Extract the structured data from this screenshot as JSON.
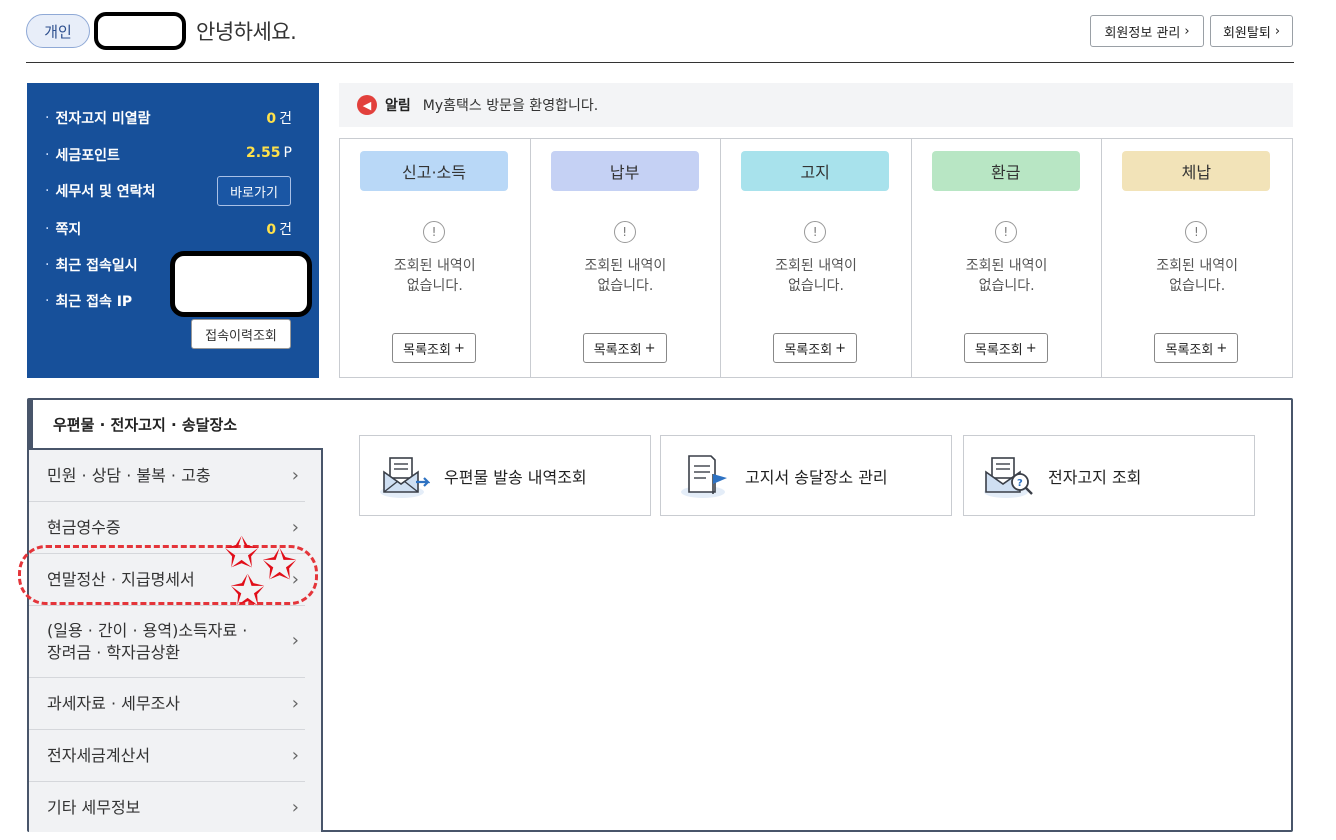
{
  "header": {
    "badge": "개인",
    "greeting": "안녕하세요.",
    "buttons": [
      {
        "label": "회원정보 관리",
        "chev": "›"
      },
      {
        "label": "회원탈퇴",
        "chev": "›"
      }
    ]
  },
  "info_box": {
    "rows": [
      {
        "label": "전자고지 미열람",
        "value": "0",
        "unit": "건"
      },
      {
        "label": "세금포인트",
        "value": "2.55",
        "unit": "P"
      },
      {
        "label": "세무서 및 연락처",
        "button": "바로가기"
      },
      {
        "label": "쪽지",
        "value": "0",
        "unit": "건"
      },
      {
        "label": "최근 접속일시"
      },
      {
        "label": "최근 접속 IP"
      }
    ],
    "history_button": "접속이력조회",
    "bullet": "·"
  },
  "notice": {
    "icon": "megaphone-icon",
    "label": "알림",
    "text": "My홈택스 방문을 환영합니다."
  },
  "categories": [
    {
      "title": "신고·소득",
      "color": "#b9d8f7",
      "message_1": "조회된 내역이",
      "message_2": "없습니다.",
      "button": "목록조회",
      "plus": "+"
    },
    {
      "title": "납부",
      "color": "#c5d1f4",
      "message_1": "조회된 내역이",
      "message_2": "없습니다.",
      "button": "목록조회",
      "plus": "+"
    },
    {
      "title": "고지",
      "color": "#a8e2ec",
      "message_1": "조회된 내역이",
      "message_2": "없습니다.",
      "button": "목록조회",
      "plus": "+"
    },
    {
      "title": "환급",
      "color": "#b8e6c4",
      "message_1": "조회된 내역이",
      "message_2": "없습니다.",
      "button": "목록조회",
      "plus": "+"
    },
    {
      "title": "체납",
      "color": "#f2e3b8",
      "message_1": "조회된 내역이",
      "message_2": "없습니다.",
      "button": "목록조회",
      "plus": "+"
    }
  ],
  "section": {
    "title": "우편물 · 전자고지 · 송달장소"
  },
  "menu": [
    {
      "label": "민원 · 상담 · 불복 · 고충"
    },
    {
      "label": "현금영수증"
    },
    {
      "label": "연말정산 · 지급명세서"
    },
    {
      "label_1": "(일용 · 간이 · 용역)소득자료 ·",
      "label_2": "장려금 · 학자금상환"
    },
    {
      "label": "과세자료 · 세무조사"
    },
    {
      "label": "전자세금계산서"
    },
    {
      "label": "기타 세무정보"
    }
  ],
  "services": [
    {
      "label": "우편물 발송 내역조회",
      "icon": "mail-send-icon"
    },
    {
      "label": "고지서 송달장소 관리",
      "icon": "document-flag-icon"
    },
    {
      "label": "전자고지 조회",
      "icon": "mail-search-icon"
    }
  ],
  "alert_glyph": "!",
  "chevron": "›",
  "star_glyph": "✩"
}
